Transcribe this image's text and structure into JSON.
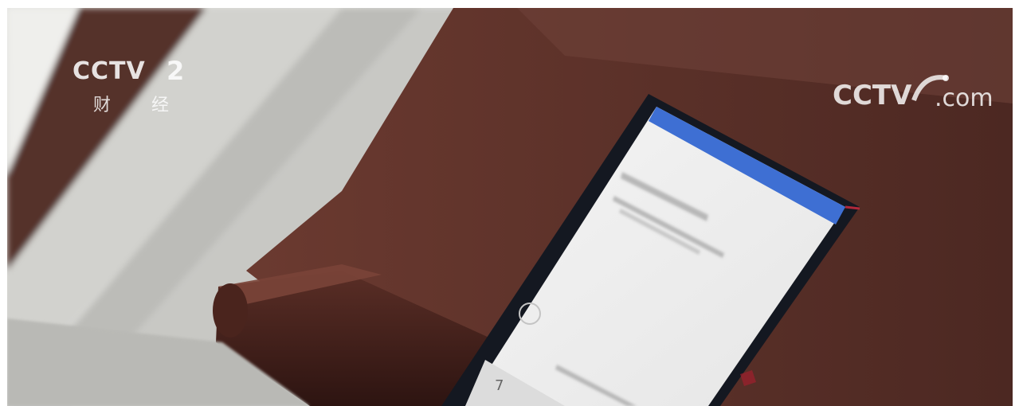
{
  "logos": {
    "channel": {
      "wordmark": "CCTV",
      "channel_number": "2",
      "channel_name": "财 经"
    },
    "site": {
      "wordmark": "CCTV",
      "domain": ".com"
    }
  },
  "scene": {
    "description_icon": "phone-on-wooden-railing",
    "colors": {
      "wood": "#5a2f26",
      "wood_dark": "#3a1c16",
      "phone_screen": "#f2f2f2",
      "phone_header": "#3f6fd1",
      "background_light": "#d6d6d2"
    }
  }
}
